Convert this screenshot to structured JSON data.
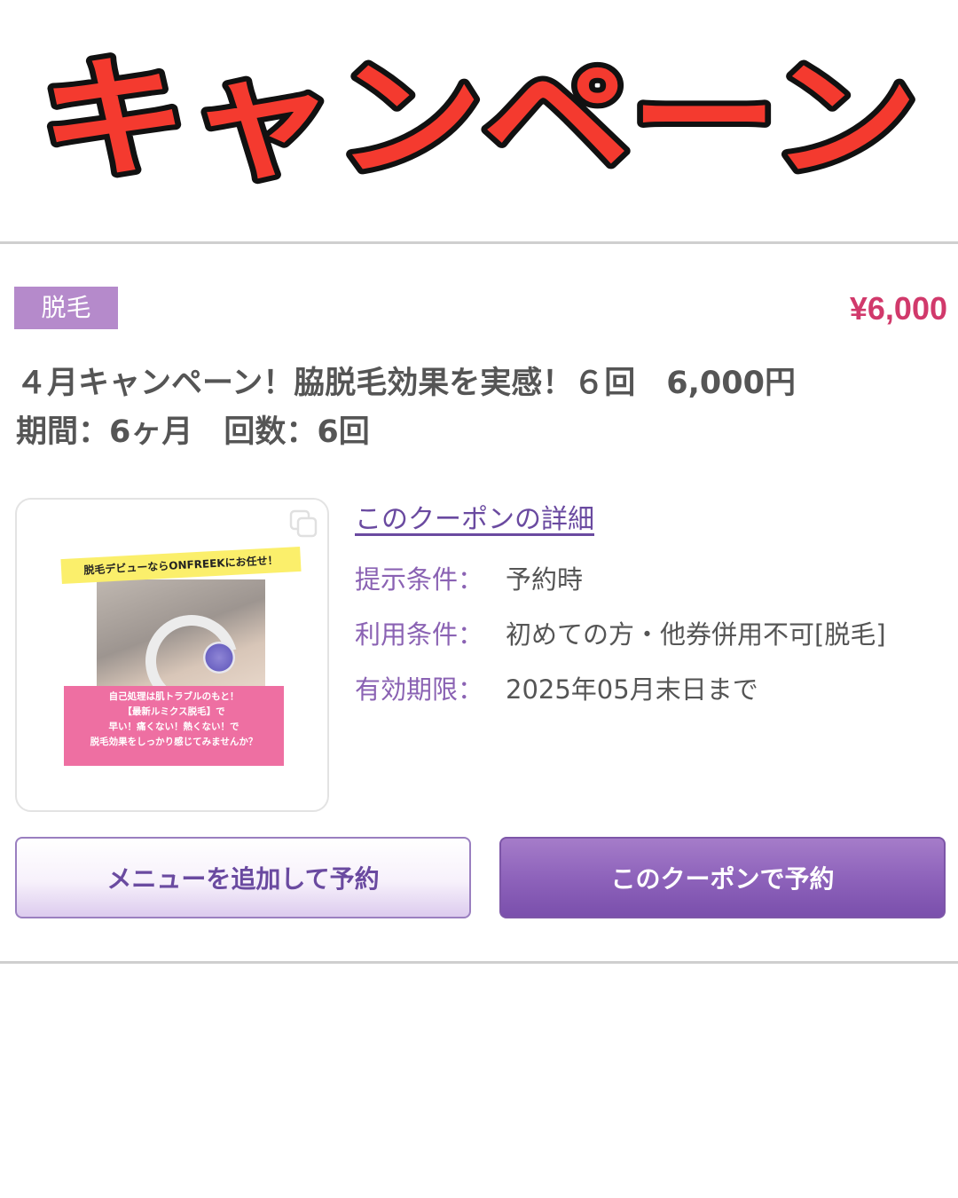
{
  "banner": {
    "text": "キャンペーン",
    "color": "#f43a2f"
  },
  "coupon": {
    "category_tag": "脱毛",
    "price": "¥6,000",
    "title_line1": "４月キャンペーン！脇脱毛効果を実感！６回　6,000円",
    "title_line2": "期間：6ヶ月　回数：6回",
    "image": {
      "copy_icon": "copy-icon",
      "banner_text": "脱毛デビューならONFREEKにお任せ！",
      "pink_lines": [
        "自己処理は肌トラブルのもと！",
        "【最新ルミクス脱毛】で",
        "早い！痛くない！熱くない！で",
        "脱毛効果をしっかり感じてみませんか？"
      ]
    },
    "detail_link": "このクーポンの詳細",
    "conditions": [
      {
        "label": "提示条件：",
        "value": "予約時"
      },
      {
        "label": "利用条件：",
        "value": "初めての方・他券併用不可[脱毛]"
      },
      {
        "label": "有効期限：",
        "value": "2025年05月末日まで"
      }
    ],
    "buttons": {
      "add_menu": "メニューを追加して予約",
      "reserve": "このクーポンで予約"
    },
    "colors": {
      "accent": "#8e63bb",
      "price": "#d1396b",
      "tag": "#b58acb"
    }
  }
}
